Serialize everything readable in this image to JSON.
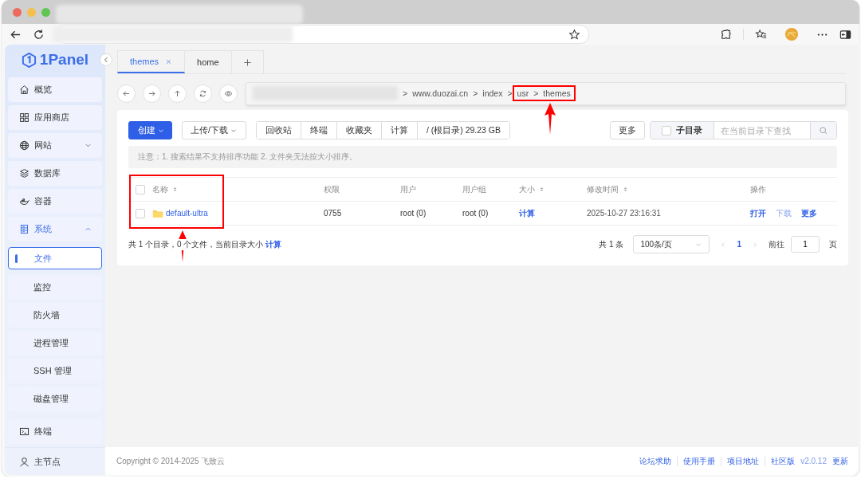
{
  "sidebar": {
    "logo": "1Panel",
    "items": [
      {
        "label": "概览",
        "selected": false
      },
      {
        "label": "应用商店",
        "selected": false
      },
      {
        "label": "网站",
        "selected": false,
        "expanded": false
      },
      {
        "label": "数据库",
        "selected": false
      },
      {
        "label": "容器",
        "selected": false
      },
      {
        "label": "系统",
        "selected": false,
        "expanded": true,
        "children": [
          {
            "label": "文件",
            "selected": true
          },
          {
            "label": "监控",
            "selected": false
          },
          {
            "label": "防火墙",
            "selected": false
          },
          {
            "label": "进程管理",
            "selected": false
          },
          {
            "label": "SSH 管理",
            "selected": false
          },
          {
            "label": "磁盘管理",
            "selected": false
          }
        ]
      },
      {
        "label": "终端",
        "selected": false
      }
    ],
    "node": "主节点"
  },
  "tabs": [
    {
      "label": "themes",
      "selected": true
    },
    {
      "label": "home",
      "selected": false
    }
  ],
  "path": {
    "separator": ">",
    "crumbs": [
      "www.duozai.cn",
      "index",
      "usr",
      "themes"
    ]
  },
  "toolbar": {
    "create": "创建",
    "transfer": "上传/下载",
    "group": [
      "回收站",
      "终端",
      "收藏夹",
      "计算",
      "/ (根目录) 29.23 GB"
    ],
    "more": "更多",
    "subdir": {
      "label": "子目录",
      "checked": false
    },
    "search": {
      "placeholder": "在当前目录下查找"
    }
  },
  "notice": "注意：1. 搜索结果不支持排序功能 2. 文件夹无法按大小排序。",
  "table": {
    "all_checked": false,
    "columns": [
      {
        "label": "名称",
        "sortable": true
      },
      {
        "label": "权限",
        "sortable": false
      },
      {
        "label": "用户",
        "sortable": false
      },
      {
        "label": "用户组",
        "sortable": false
      },
      {
        "label": "大小",
        "sortable": true
      },
      {
        "label": "修改时间",
        "sortable": true
      },
      {
        "label": "操作",
        "sortable": false
      }
    ],
    "rows": [
      {
        "checked": false,
        "kind": "folder",
        "name": "default-ultra",
        "permission": "0755",
        "user": "root (0)",
        "group": "root (0)",
        "size": "计算",
        "modified": "2025-10-27 23:16:31",
        "actions": [
          {
            "label": "打开",
            "disabled": false
          },
          {
            "label": "下载",
            "disabled": true
          },
          {
            "label": "更多",
            "disabled": false
          }
        ]
      }
    ]
  },
  "summary": {
    "text": "共 1 个目录，0 个文件，当前目录大小",
    "link": "计算"
  },
  "pagination": {
    "total": "共 1 条",
    "page_size": "100条/页",
    "pages": [
      {
        "label": "1",
        "selected": true
      }
    ],
    "goto": "前往",
    "page_input": "1",
    "page_unit": "页"
  },
  "footer": {
    "copyright": "Copyright © 2014-2025 飞致云",
    "links": [
      "论坛求助",
      "使用手册",
      "项目地址",
      "社区版"
    ],
    "version": "v2.0.12",
    "update": "更新"
  },
  "annotations": [
    {
      "kind": "box-arrow"
    },
    {
      "kind": "box-arrow"
    }
  ]
}
